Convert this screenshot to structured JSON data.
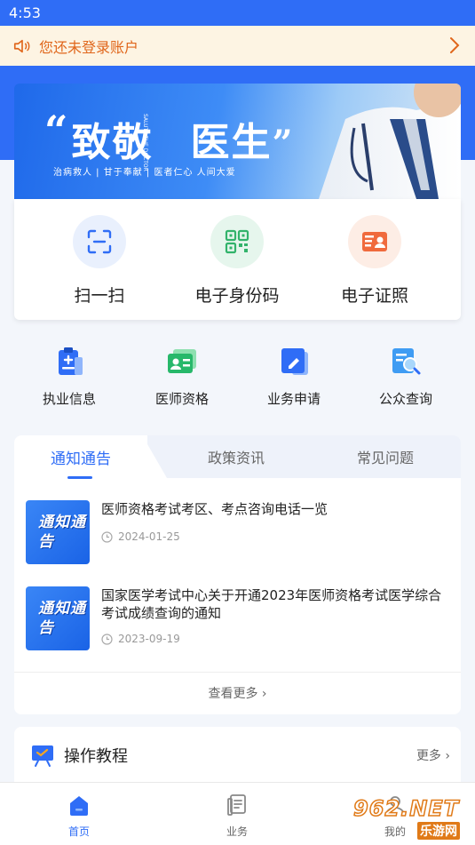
{
  "status_bar": {
    "time": "4:53"
  },
  "login_notice": {
    "text": "您还未登录账户"
  },
  "banner": {
    "headline_1": "致敬",
    "headline_2": "医生",
    "salute_text": "SALUTE THE DOCTOR",
    "subtitle": "治病救人 | 甘于奉献 | 医者仁心 人间大爱"
  },
  "quick_actions": [
    {
      "label": "扫一扫",
      "icon": "scan-icon",
      "color": "#e9f0fd"
    },
    {
      "label": "电子身份码",
      "icon": "qr-code-icon",
      "color": "#e6f6ed"
    },
    {
      "label": "电子证照",
      "icon": "certificate-icon",
      "color": "#fdede5"
    }
  ],
  "services": [
    {
      "label": "执业信息",
      "icon": "practice-info-icon"
    },
    {
      "label": "医师资格",
      "icon": "qualification-icon"
    },
    {
      "label": "业务申请",
      "icon": "application-icon"
    },
    {
      "label": "公众查询",
      "icon": "public-search-icon"
    }
  ],
  "news": {
    "tabs": [
      "通知通告",
      "政策资讯",
      "常见问题"
    ],
    "active_tab": "通知通告",
    "thumb_text": "通知通告",
    "items": [
      {
        "title": "医师资格考试考区、考点咨询电话一览",
        "date": "2024-01-25"
      },
      {
        "title": "国家医学考试中心关于开通2023年医师资格考试医学综合考试成绩查询的通知",
        "date": "2023-09-19"
      }
    ],
    "see_more": "查看更多 ›"
  },
  "tutorial": {
    "title": "操作教程",
    "more": "更多 ›"
  },
  "bottom_nav": [
    {
      "label": "首页",
      "icon": "home-icon",
      "active": true
    },
    {
      "label": "业务",
      "icon": "business-icon",
      "active": false
    },
    {
      "label": "我的",
      "icon": "profile-icon",
      "active": false
    }
  ],
  "watermark": {
    "main": "962.NET",
    "sub": "乐游网"
  },
  "colors": {
    "primary": "#2f6df6",
    "notice_bg": "#fdf4e3",
    "notice_text": "#e0661b"
  }
}
